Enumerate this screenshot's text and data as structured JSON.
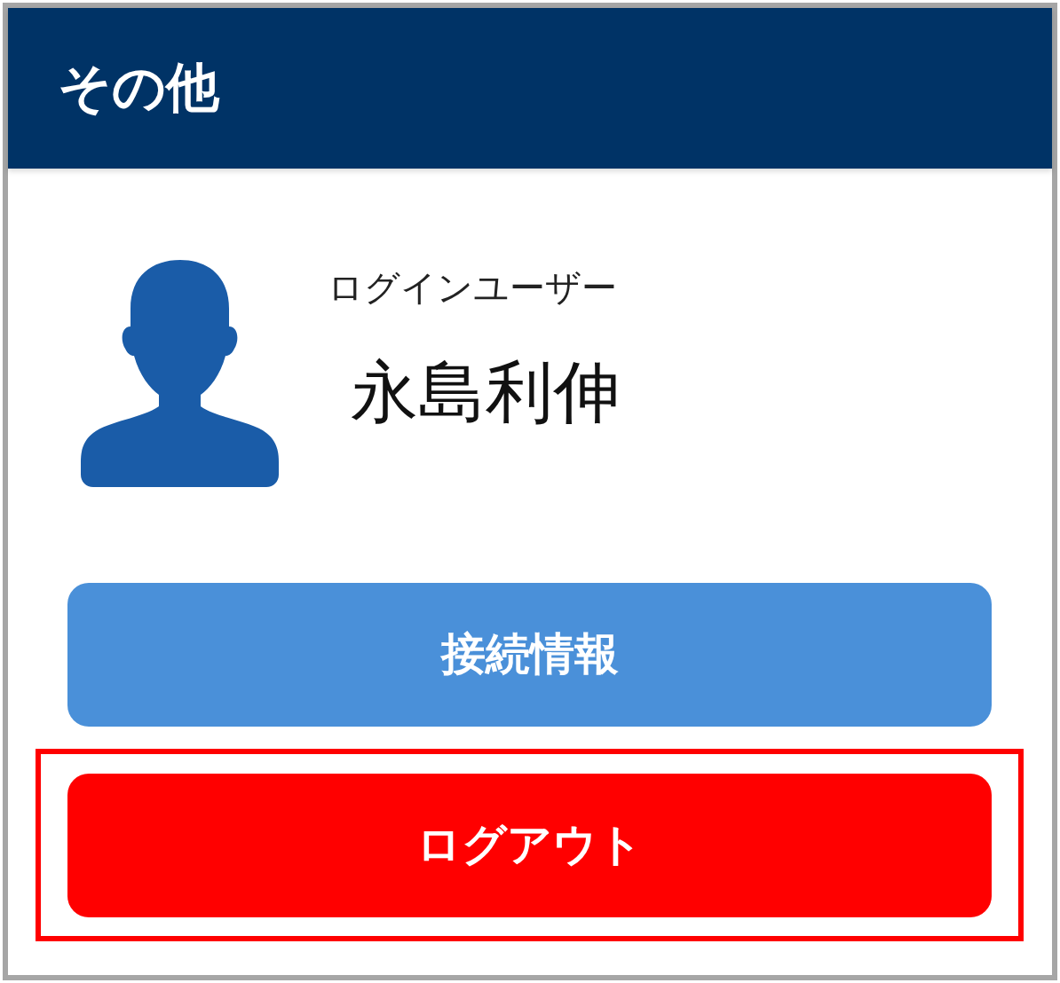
{
  "header": {
    "title": "その他"
  },
  "user": {
    "label": "ログインユーザー",
    "name": "永島利伸"
  },
  "buttons": [
    {
      "label": "接続情報",
      "kind": "primary",
      "highlighted": false
    },
    {
      "label": "ログアウト",
      "kind": "danger",
      "highlighted": true
    }
  ]
}
